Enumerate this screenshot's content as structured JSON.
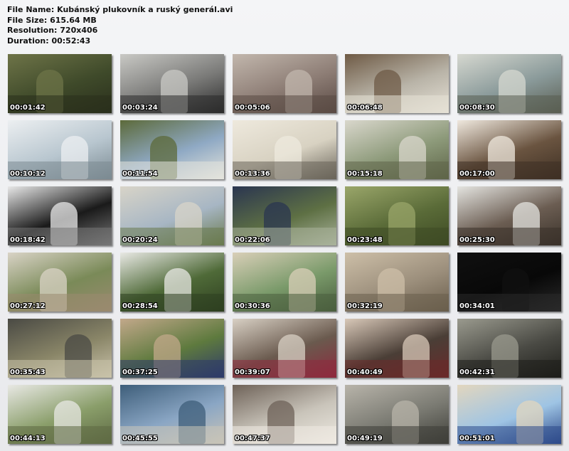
{
  "header": {
    "file_name": "File Name: Kubánský plukovník a ruský generál.avi",
    "file_size": "File Size: 615.64 MB",
    "resolution": "Resolution: 720x406",
    "duration": "Duration: 00:52:43"
  },
  "thumbnails": [
    {
      "time": "00:01:42",
      "scene": "forest-ruins",
      "colors": [
        "#3f4a2a",
        "#6e7448",
        "#2a2f1c"
      ]
    },
    {
      "time": "00:03:24",
      "scene": "capitol-bw",
      "colors": [
        "#7a7a78",
        "#c9c9c5",
        "#2b2b2b"
      ]
    },
    {
      "time": "00:05:06",
      "scene": "tall-building",
      "colors": [
        "#8d7d75",
        "#c2b7ad",
        "#5a4a44"
      ]
    },
    {
      "time": "00:06:48",
      "scene": "hands-coffee",
      "colors": [
        "#b9b4a8",
        "#6e5a45",
        "#e6e1d6"
      ]
    },
    {
      "time": "00:08:30",
      "scene": "street-people",
      "colors": [
        "#8a9a9a",
        "#d6d8d0",
        "#5a5e52"
      ]
    },
    {
      "time": "00:10:12",
      "scene": "man-in-car",
      "colors": [
        "#b8c6cf",
        "#eceff1",
        "#7b8a92"
      ]
    },
    {
      "time": "00:11:54",
      "scene": "missile-display",
      "colors": [
        "#8fa9c4",
        "#5c6a3a",
        "#e4e4dc"
      ]
    },
    {
      "time": "00:13:36",
      "scene": "map-cuba",
      "colors": [
        "#d8d2c2",
        "#eee9dd",
        "#6a655a"
      ]
    },
    {
      "time": "00:15:18",
      "scene": "two-men-field",
      "colors": [
        "#8d9a7a",
        "#d9d7cc",
        "#5e6548"
      ]
    },
    {
      "time": "00:17:00",
      "scene": "man-interior",
      "colors": [
        "#6a5440",
        "#efe8de",
        "#3e3024"
      ]
    },
    {
      "time": "00:18:42",
      "scene": "bw-ship",
      "colors": [
        "#1a1a1a",
        "#e8e8e8",
        "#777777"
      ]
    },
    {
      "time": "00:20:24",
      "scene": "building-path",
      "colors": [
        "#a7b6c4",
        "#d8d4c8",
        "#6a7a4e"
      ]
    },
    {
      "time": "00:22:06",
      "scene": "man-road",
      "colors": [
        "#5e7044",
        "#2a3550",
        "#a9b29b"
      ]
    },
    {
      "time": "00:23:48",
      "scene": "tall-grass",
      "colors": [
        "#5a6b38",
        "#9aa66a",
        "#3e4a24"
      ]
    },
    {
      "time": "00:25:30",
      "scene": "hat-man-shed",
      "colors": [
        "#6b5d52",
        "#e4e4e0",
        "#3a322a"
      ]
    },
    {
      "time": "00:27:12",
      "scene": "house-man",
      "colors": [
        "#7a8a58",
        "#d9d3c6",
        "#9a8a70"
      ]
    },
    {
      "time": "00:28:54",
      "scene": "man-talking-bush",
      "colors": [
        "#4f6a38",
        "#e8e8e4",
        "#2e3f20"
      ]
    },
    {
      "time": "00:30:36",
      "scene": "two-men-hills",
      "colors": [
        "#7a9a6a",
        "#d9cfb8",
        "#4a5e3e"
      ]
    },
    {
      "time": "00:32:19",
      "scene": "concrete-ruin",
      "colors": [
        "#9c8f7c",
        "#cdbfa8",
        "#6a5e4c"
      ]
    },
    {
      "time": "00:34:01",
      "scene": "black-frame",
      "colors": [
        "#080808",
        "#101010",
        "#2a2a2a"
      ]
    },
    {
      "time": "00:35:43",
      "scene": "tractor-man",
      "colors": [
        "#8a8668",
        "#4a4a44",
        "#c9c2aa"
      ]
    },
    {
      "time": "00:37:25",
      "scene": "old-man-hat",
      "colors": [
        "#5e7a3e",
        "#c2a88a",
        "#2e3a6a"
      ]
    },
    {
      "time": "00:39:07",
      "scene": "couple-interior",
      "colors": [
        "#6a5a4e",
        "#d8d0c4",
        "#8e2a3e"
      ]
    },
    {
      "time": "00:40:49",
      "scene": "old-woman",
      "colors": [
        "#4a3e36",
        "#d8c8b8",
        "#6a2a2a"
      ]
    },
    {
      "time": "00:42:31",
      "scene": "bw-machinery",
      "colors": [
        "#4a4a44",
        "#9a9a8e",
        "#1e1e1a"
      ]
    },
    {
      "time": "00:44:13",
      "scene": "two-men-coast",
      "colors": [
        "#8a9e6a",
        "#e8e8e4",
        "#5e6a44"
      ]
    },
    {
      "time": "00:45:55",
      "scene": "havana-coast",
      "colors": [
        "#8aa6c4",
        "#3e5e7a",
        "#c9c4b8"
      ]
    },
    {
      "time": "00:47:37",
      "scene": "driver-white-car",
      "colors": [
        "#c9c4ba",
        "#6e6258",
        "#eeeae2"
      ]
    },
    {
      "time": "00:49:19",
      "scene": "car-interior",
      "colors": [
        "#7a7a72",
        "#b8b4aa",
        "#3e3e38"
      ]
    },
    {
      "time": "00:51:01",
      "scene": "beach-men",
      "colors": [
        "#9ec4e4",
        "#e2d6be",
        "#2e4a8a"
      ]
    }
  ]
}
